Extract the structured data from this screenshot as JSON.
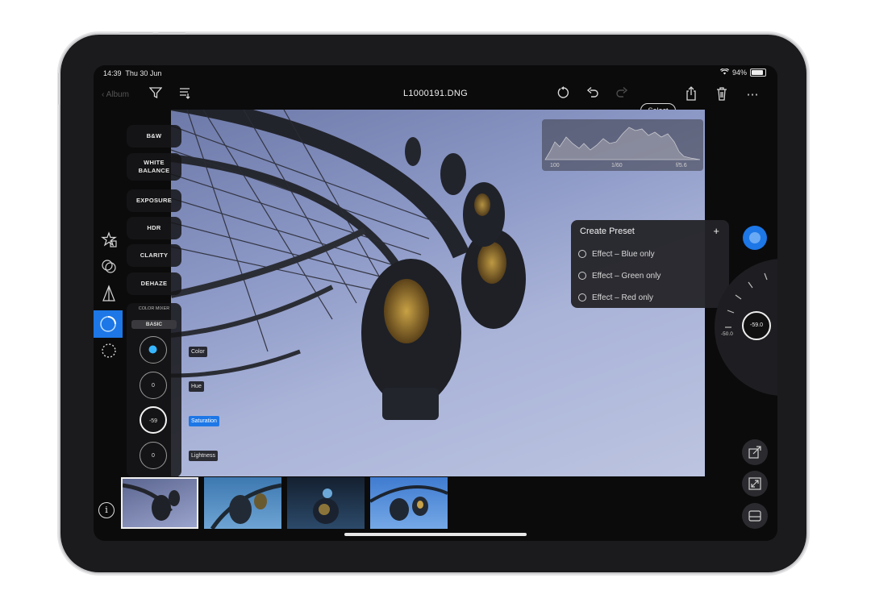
{
  "status": {
    "time": "14:39",
    "date": "Thu 30 Jun",
    "battery": "94%"
  },
  "toolbar": {
    "back_label": "Album",
    "file_title": "L1000191.DNG",
    "select_label": "Select",
    "icons": [
      "filter-icon",
      "sort-icon",
      "revert-icon",
      "undo-icon",
      "redo-icon",
      "share-icon",
      "trash-icon",
      "more-icon"
    ]
  },
  "histogram": {
    "iso": "100",
    "speed": "1/60",
    "aperture": "f/5.6"
  },
  "adjustments": [
    "B&W",
    "WHITE BALANCE",
    "EXPOSURE",
    "HDR",
    "CLARITY",
    "DEHAZE"
  ],
  "color_panel": {
    "title": "COLOR MIXER",
    "tab": "BASIC",
    "dials": [
      {
        "value": "",
        "label": "Color"
      },
      {
        "value": "0",
        "label": "Hue"
      },
      {
        "value": "-59",
        "label": "Saturation"
      },
      {
        "value": "0",
        "label": "Lightness"
      }
    ]
  },
  "preset_menu": {
    "title": "Create Preset",
    "add": "+",
    "items": [
      "Effect – Blue only",
      "Effect – Green only",
      "Effect – Red only"
    ]
  },
  "wheel": {
    "value": "-59.0",
    "tick_label": "-50.0"
  },
  "info_label": "i",
  "colors": {
    "accent": "#1d77e6",
    "panel": "#161618",
    "screen": "#0b0b0c"
  }
}
